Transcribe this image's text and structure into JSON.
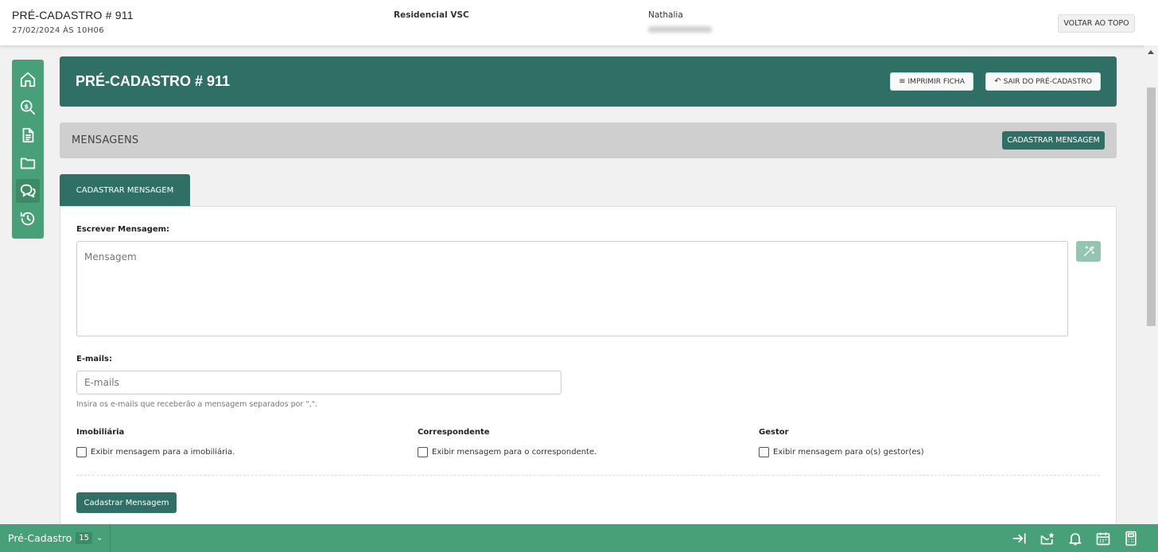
{
  "topbar": {
    "title": "PRÉ-CADASTRO # 911",
    "date": "27/02/2024 ÀS 10H06",
    "project": "Residencial VSC",
    "user": "Nathalia",
    "back_to_top": "VOLTAR AO TOPO"
  },
  "sidenav": {
    "items": [
      {
        "icon": "home-icon"
      },
      {
        "icon": "search-dollar-icon"
      },
      {
        "icon": "document-icon"
      },
      {
        "icon": "folder-icon"
      },
      {
        "icon": "chat-icon",
        "active": true
      },
      {
        "icon": "history-icon"
      }
    ]
  },
  "banner": {
    "title": "PRÉ-CADASTRO # 911",
    "print_label": "IMPRIMIR FICHA",
    "exit_label": "SAIR DO PRÉ-CADASTRO"
  },
  "messages": {
    "title": "MENSAGENS",
    "register_button": "CADASTRAR MENSAGEM"
  },
  "tab": {
    "label": "CADASTRAR MENSAGEM"
  },
  "form": {
    "message_label": "Escrever Mensagem:",
    "message_placeholder": "Mensagem",
    "emails_label": "E-mails:",
    "emails_placeholder": "E-mails",
    "emails_help": "Insira os e-mails que receberão a mensagem separados por \",\".",
    "groups": [
      {
        "title": "Imobiliária",
        "checkbox": "Exibir mensagem para a imobiliária."
      },
      {
        "title": "Correspondente",
        "checkbox": "Exibir mensagem para o correspondente."
      },
      {
        "title": "Gestor",
        "checkbox": "Exibir mensagem para o(s) gestor(es)"
      }
    ],
    "submit_label": "Cadastrar Mensagem"
  },
  "bottombar": {
    "section_label": "Pré-Cadastro",
    "section_count": "15",
    "icons": [
      "arrow-to-right-icon",
      "envelope-star-icon",
      "bell-icon",
      "calendar-icon",
      "calculator-icon"
    ]
  },
  "colors": {
    "primary_dark": "#2f6f65",
    "primary_green": "#47a077",
    "gray_bar": "#cfcfcf"
  }
}
